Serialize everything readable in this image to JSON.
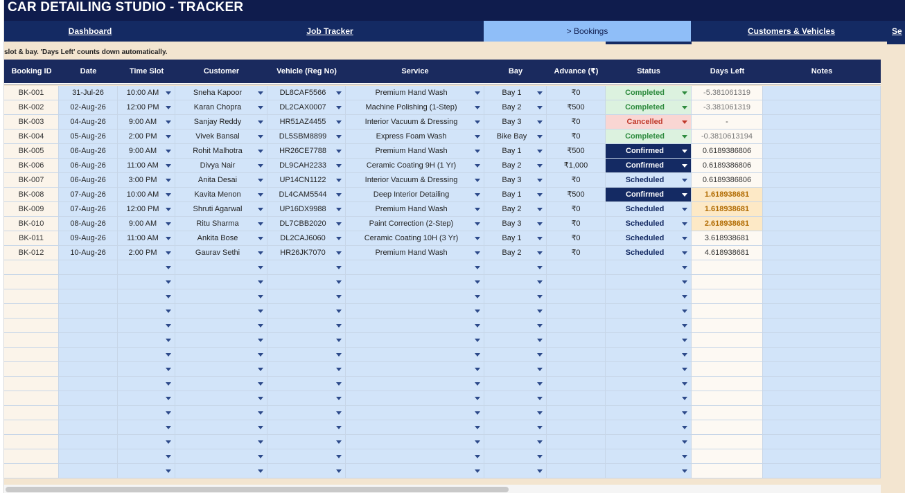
{
  "app": {
    "title": "CAR DETAILING STUDIO - TRACKER"
  },
  "nav": {
    "tabs": [
      {
        "label": "Dashboard",
        "active": false
      },
      {
        "label": "Job Tracker",
        "active": false
      },
      {
        "label": "> Bookings",
        "active": true
      },
      {
        "label": "Customers & Vehicles",
        "active": false
      },
      {
        "label": "Se",
        "active": false
      }
    ]
  },
  "note": "slot & bay.  'Days Left' counts down automatically.",
  "table": {
    "columns": [
      "Booking ID",
      "Date",
      "Time Slot",
      "Customer",
      "Vehicle (Reg No)",
      "Service",
      "Bay",
      "Advance (₹)",
      "Status",
      "Days Left",
      "Notes"
    ],
    "rows": [
      {
        "id": "BK-001",
        "date": "31-Jul-26",
        "time": "10:00 AM",
        "customer": "Sneha Kapoor",
        "vehicle": "DL8CAF5566",
        "service": "Premium Hand Wash",
        "bay": "Bay 1",
        "advance": "₹0",
        "status": "Completed",
        "days": "-5.381061319",
        "notes": ""
      },
      {
        "id": "BK-002",
        "date": "02-Aug-26",
        "time": "12:00 PM",
        "customer": "Karan Chopra",
        "vehicle": "DL2CAX0007",
        "service": "Machine Polishing (1-Step)",
        "bay": "Bay 2",
        "advance": "₹500",
        "status": "Completed",
        "days": "-3.381061319",
        "notes": ""
      },
      {
        "id": "BK-003",
        "date": "04-Aug-26",
        "time": "9:00 AM",
        "customer": "Sanjay Reddy",
        "vehicle": "HR51AZ4455",
        "service": "Interior Vacuum & Dressing",
        "bay": "Bay 3",
        "advance": "₹0",
        "status": "Cancelled",
        "days": "-",
        "notes": ""
      },
      {
        "id": "BK-004",
        "date": "05-Aug-26",
        "time": "2:00 PM",
        "customer": "Vivek Bansal",
        "vehicle": "DL5SBM8899",
        "service": "Express Foam Wash",
        "bay": "Bike Bay",
        "advance": "₹0",
        "status": "Completed",
        "days": "-0.3810613194",
        "notes": ""
      },
      {
        "id": "BK-005",
        "date": "06-Aug-26",
        "time": "9:00 AM",
        "customer": "Rohit Malhotra",
        "vehicle": "HR26CE7788",
        "service": "Premium Hand Wash",
        "bay": "Bay 1",
        "advance": "₹500",
        "status": "Confirmed",
        "days": "0.6189386806",
        "notes": ""
      },
      {
        "id": "BK-006",
        "date": "06-Aug-26",
        "time": "11:00 AM",
        "customer": "Divya Nair",
        "vehicle": "DL9CAH2233",
        "service": "Ceramic Coating 9H (1 Yr)",
        "bay": "Bay 2",
        "advance": "₹1,000",
        "status": "Confirmed",
        "days": "0.6189386806",
        "notes": ""
      },
      {
        "id": "BK-007",
        "date": "06-Aug-26",
        "time": "3:00 PM",
        "customer": "Anita Desai",
        "vehicle": "UP14CN1122",
        "service": "Interior Vacuum & Dressing",
        "bay": "Bay 3",
        "advance": "₹0",
        "status": "Scheduled",
        "days": "0.6189386806",
        "notes": ""
      },
      {
        "id": "BK-008",
        "date": "07-Aug-26",
        "time": "10:00 AM",
        "customer": "Kavita Menon",
        "vehicle": "DL4CAM5544",
        "service": "Deep Interior Detailing",
        "bay": "Bay 1",
        "advance": "₹500",
        "status": "Confirmed",
        "days": "1.618938681",
        "notes": ""
      },
      {
        "id": "BK-009",
        "date": "07-Aug-26",
        "time": "12:00 PM",
        "customer": "Shruti Agarwal",
        "vehicle": "UP16DX9988",
        "service": "Premium Hand Wash",
        "bay": "Bay 2",
        "advance": "₹0",
        "status": "Scheduled",
        "days": "1.618938681",
        "notes": ""
      },
      {
        "id": "BK-010",
        "date": "08-Aug-26",
        "time": "9:00 AM",
        "customer": "Ritu Sharma",
        "vehicle": "DL7CBB2020",
        "service": "Paint Correction (2-Step)",
        "bay": "Bay 3",
        "advance": "₹0",
        "status": "Scheduled",
        "days": "2.618938681",
        "notes": ""
      },
      {
        "id": "BK-011",
        "date": "09-Aug-26",
        "time": "11:00 AM",
        "customer": "Ankita Bose",
        "vehicle": "DL2CAJ6060",
        "service": "Ceramic Coating 10H (3 Yr)",
        "bay": "Bay 1",
        "advance": "₹0",
        "status": "Scheduled",
        "days": "3.618938681",
        "notes": ""
      },
      {
        "id": "BK-012",
        "date": "10-Aug-26",
        "time": "2:00 PM",
        "customer": "Gaurav Sethi",
        "vehicle": "HR26JK7070",
        "service": "Premium Hand Wash",
        "bay": "Bay 2",
        "advance": "₹0",
        "status": "Scheduled",
        "days": "4.618938681",
        "notes": ""
      }
    ]
  },
  "colors": {
    "title_bg": "#0f1c4d",
    "nav_bg": "#142a63",
    "active_tab": "#8fbef8",
    "header_bg": "#1a2a5e",
    "cell_blue": "#d2e4f9",
    "completed": "#2e8b3e",
    "cancelled": "#c0392b",
    "confirmed_bg": "#142a63",
    "days_soon": "#b06a00"
  },
  "icons": {
    "dropdown": "chevron-down-icon"
  }
}
